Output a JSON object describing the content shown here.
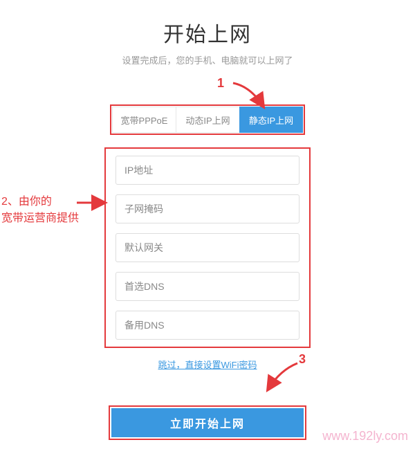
{
  "header": {
    "title": "开始上网",
    "subtitle": "设置完成后，您的手机、电脑就可以上网了"
  },
  "tabs": {
    "items": [
      {
        "label": "宽带PPPoE",
        "active": false
      },
      {
        "label": "动态IP上网",
        "active": false
      },
      {
        "label": "静态IP上网",
        "active": true
      }
    ]
  },
  "form": {
    "fields": [
      {
        "placeholder": "IP地址",
        "value": ""
      },
      {
        "placeholder": "子网掩码",
        "value": ""
      },
      {
        "placeholder": "默认网关",
        "value": ""
      },
      {
        "placeholder": "首选DNS",
        "value": ""
      },
      {
        "placeholder": "备用DNS",
        "value": ""
      }
    ]
  },
  "skip_link": "跳过，直接设置WiFi密码",
  "submit_label": "立即开始上网",
  "annotations": {
    "step1": "1",
    "step2_line1": "2、由你的",
    "step2_line2": "宽带运营商提供",
    "step3": "3"
  },
  "watermark": "www.192ly.com",
  "colors": {
    "accent": "#3a98e0",
    "annotation": "#e4393c"
  }
}
